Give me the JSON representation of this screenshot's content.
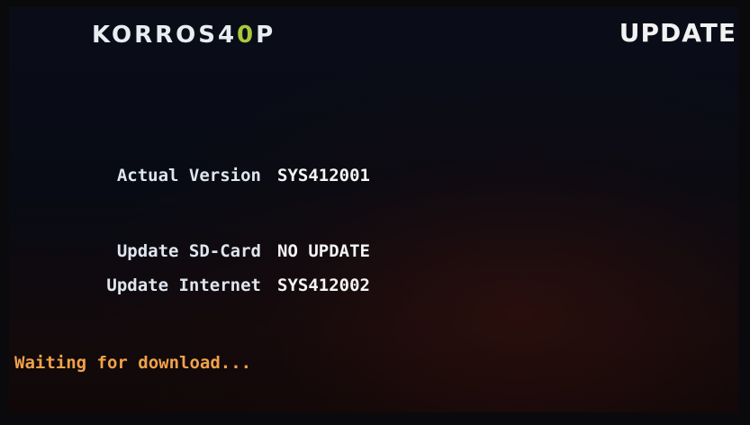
{
  "header": {
    "brand_main": "KORROS4",
    "brand_accent": "0",
    "brand_tail": "P",
    "title": "UPDATE"
  },
  "info": {
    "actual_version_label": "Actual Version",
    "actual_version_value": "SYS412001",
    "sd_card_label": "Update SD-Card",
    "sd_card_value": "NO UPDATE",
    "internet_label": "Update Internet",
    "internet_value": "SYS412002"
  },
  "status": {
    "message": "Waiting for download..."
  },
  "colors": {
    "accent": "#a9c93a",
    "status_text": "#f0a24a",
    "background": "#080b14"
  }
}
